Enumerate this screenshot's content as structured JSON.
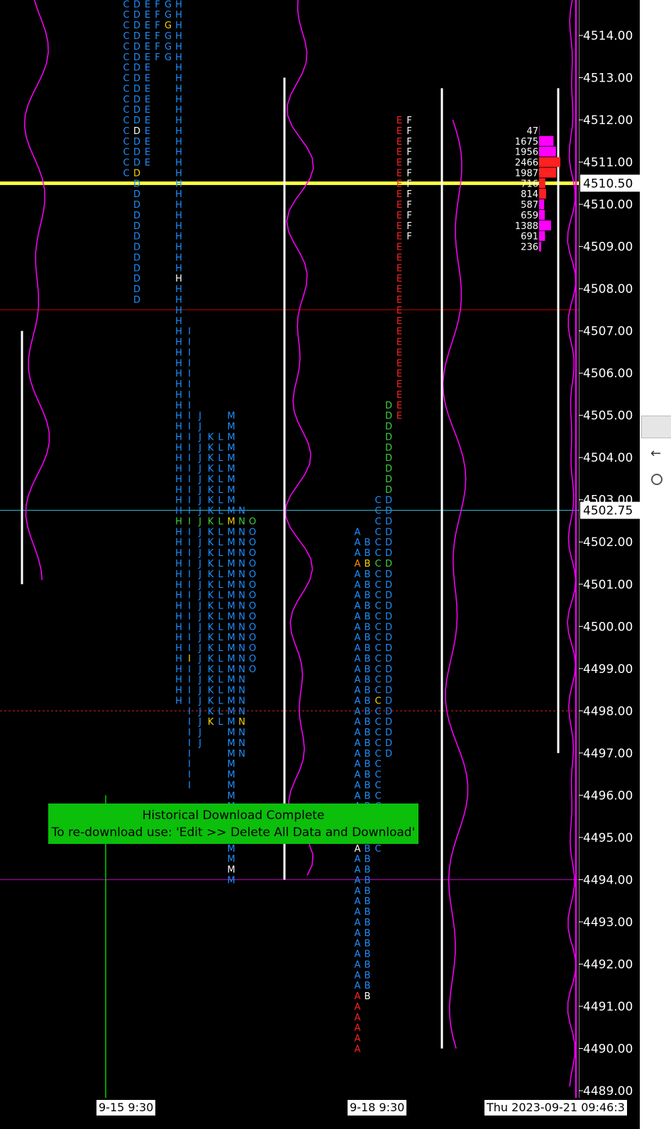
{
  "price_axis": {
    "ticks": [
      "4514.00",
      "4513.00",
      "4512.00",
      "4511.00",
      "4510.00",
      "4509.00",
      "4508.00",
      "4507.00",
      "4506.00",
      "4505.00",
      "4504.00",
      "4503.00",
      "4502.00",
      "4501.00",
      "4500.00",
      "4499.00",
      "4498.00",
      "4497.00",
      "4496.00",
      "4495.00",
      "4494.00",
      "4493.00",
      "4492.00",
      "4491.00",
      "4490.00",
      "4489.00"
    ],
    "current_price_label": "4510.50",
    "marker_price_label": "4502.75"
  },
  "time_axis": {
    "labels": [
      "9-15  9:30",
      "9-18  9:30",
      "Thu 2023-09-21  09:46:3"
    ]
  },
  "banner": {
    "line1": "Historical Download Complete",
    "line2": "To re-download use: 'Edit >> Delete All Data and Download'"
  },
  "depth_ladder": {
    "volumes": [
      "47",
      "1675",
      "1956",
      "2466",
      "1987",
      "716",
      "814",
      "587",
      "659",
      "1388",
      "691",
      "236"
    ]
  },
  "colors": {
    "background": "#000000",
    "tpo_blue": "#1e90ff",
    "tpo_yellow": "#f5d20a",
    "tpo_green": "#3fd13f",
    "tpo_red": "#ff2020",
    "profile_magenta": "#ff00ff",
    "current_price_line": "#ffff40",
    "banner": "#0bbf0b"
  },
  "chart_data": {
    "type": "tpo_market_profile",
    "ylim": [
      4488.8,
      4514.85
    ],
    "tick_size": 0.25,
    "current_price": 4510.5,
    "marker_price": 4502.75,
    "horizontal_lines": [
      {
        "price": 4510.5,
        "color": "#ffff40",
        "style": "solid"
      },
      {
        "price": 4507.5,
        "color": "#cc0000",
        "style": "solid"
      },
      {
        "price": 4502.75,
        "color": "#30c8d8",
        "style": "solid"
      },
      {
        "price": 4498.0,
        "color": "#cc2222",
        "style": "dotted"
      },
      {
        "price": 4494.0,
        "color": "#cc00cc",
        "style": "solid"
      }
    ],
    "profiles": [
      {
        "session": "9-15",
        "periods": [
          {
            "letter": "C",
            "low": 4510.75,
            "high": 4514.85
          },
          {
            "letter": "D",
            "low": 4507.75,
            "high": 4514.85
          },
          {
            "letter": "E",
            "low": 4511.0,
            "high": 4514.85
          },
          {
            "letter": "F",
            "low": 4513.5,
            "high": 4514.85
          },
          {
            "letter": "G",
            "low": 4513.5,
            "high": 4514.85
          },
          {
            "letter": "H",
            "low": 4498.25,
            "high": 4514.85
          },
          {
            "letter": "I",
            "low": 4496.25,
            "high": 4507.0
          },
          {
            "letter": "J",
            "low": 4497.25,
            "high": 4505.0
          },
          {
            "letter": "K",
            "low": 4497.75,
            "high": 4504.5
          },
          {
            "letter": "L",
            "low": 4497.75,
            "high": 4504.5
          },
          {
            "letter": "M",
            "low": 4494.0,
            "high": 4505.0
          },
          {
            "letter": "N",
            "low": 4497.0,
            "high": 4502.75
          },
          {
            "letter": "O",
            "low": 4499.0,
            "high": 4502.5
          }
        ]
      },
      {
        "session": "9-18",
        "periods": [
          {
            "letter": "A",
            "low": 4490.0,
            "high": 4502.25
          },
          {
            "letter": "B",
            "low": 4491.25,
            "high": 4502.0
          },
          {
            "letter": "C",
            "low": 4494.75,
            "high": 4503.0
          },
          {
            "letter": "D",
            "low": 4497.0,
            "high": 4505.25
          },
          {
            "letter": "E",
            "low": 4505.0,
            "high": 4512.0
          },
          {
            "letter": "F",
            "low": 4509.25,
            "high": 4512.0
          }
        ]
      }
    ]
  }
}
